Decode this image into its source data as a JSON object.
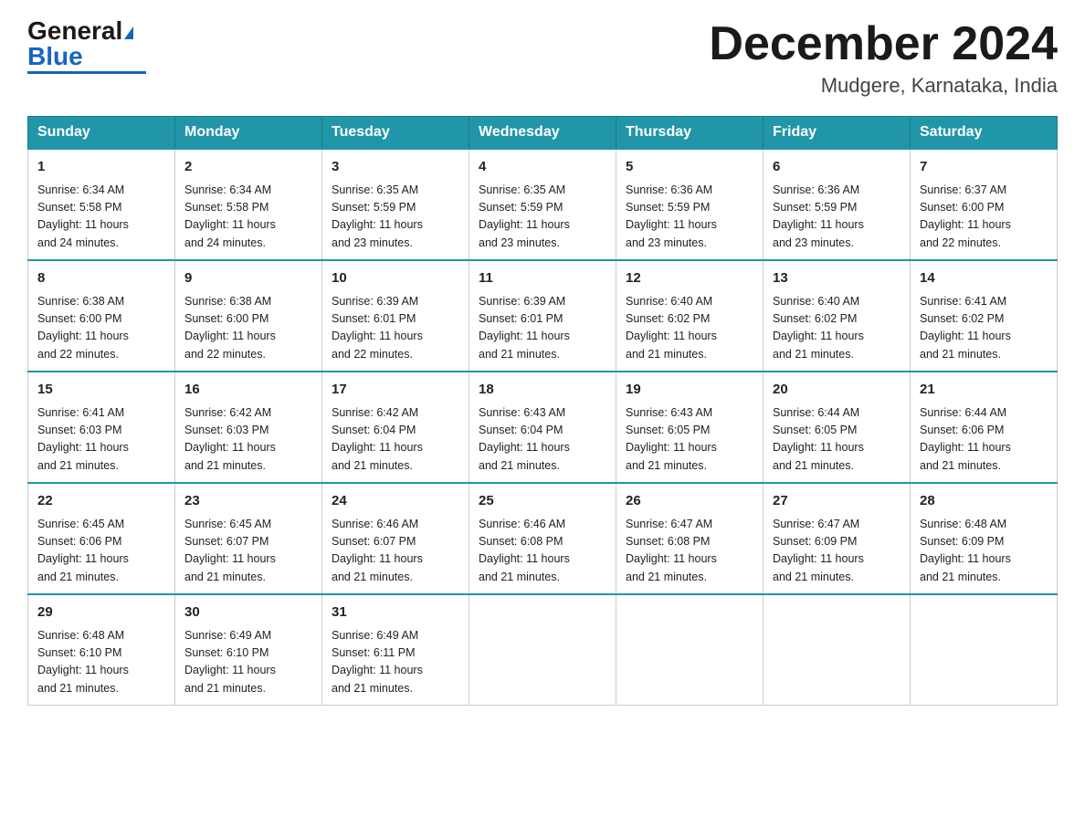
{
  "header": {
    "logo_general": "General",
    "logo_blue": "Blue",
    "month_title": "December 2024",
    "location": "Mudgere, Karnataka, India"
  },
  "days_of_week": [
    "Sunday",
    "Monday",
    "Tuesday",
    "Wednesday",
    "Thursday",
    "Friday",
    "Saturday"
  ],
  "weeks": [
    [
      {
        "day": "1",
        "sunrise": "6:34 AM",
        "sunset": "5:58 PM",
        "daylight": "11 hours and 24 minutes."
      },
      {
        "day": "2",
        "sunrise": "6:34 AM",
        "sunset": "5:58 PM",
        "daylight": "11 hours and 24 minutes."
      },
      {
        "day": "3",
        "sunrise": "6:35 AM",
        "sunset": "5:59 PM",
        "daylight": "11 hours and 23 minutes."
      },
      {
        "day": "4",
        "sunrise": "6:35 AM",
        "sunset": "5:59 PM",
        "daylight": "11 hours and 23 minutes."
      },
      {
        "day": "5",
        "sunrise": "6:36 AM",
        "sunset": "5:59 PM",
        "daylight": "11 hours and 23 minutes."
      },
      {
        "day": "6",
        "sunrise": "6:36 AM",
        "sunset": "5:59 PM",
        "daylight": "11 hours and 23 minutes."
      },
      {
        "day": "7",
        "sunrise": "6:37 AM",
        "sunset": "6:00 PM",
        "daylight": "11 hours and 22 minutes."
      }
    ],
    [
      {
        "day": "8",
        "sunrise": "6:38 AM",
        "sunset": "6:00 PM",
        "daylight": "11 hours and 22 minutes."
      },
      {
        "day": "9",
        "sunrise": "6:38 AM",
        "sunset": "6:00 PM",
        "daylight": "11 hours and 22 minutes."
      },
      {
        "day": "10",
        "sunrise": "6:39 AM",
        "sunset": "6:01 PM",
        "daylight": "11 hours and 22 minutes."
      },
      {
        "day": "11",
        "sunrise": "6:39 AM",
        "sunset": "6:01 PM",
        "daylight": "11 hours and 21 minutes."
      },
      {
        "day": "12",
        "sunrise": "6:40 AM",
        "sunset": "6:02 PM",
        "daylight": "11 hours and 21 minutes."
      },
      {
        "day": "13",
        "sunrise": "6:40 AM",
        "sunset": "6:02 PM",
        "daylight": "11 hours and 21 minutes."
      },
      {
        "day": "14",
        "sunrise": "6:41 AM",
        "sunset": "6:02 PM",
        "daylight": "11 hours and 21 minutes."
      }
    ],
    [
      {
        "day": "15",
        "sunrise": "6:41 AM",
        "sunset": "6:03 PM",
        "daylight": "11 hours and 21 minutes."
      },
      {
        "day": "16",
        "sunrise": "6:42 AM",
        "sunset": "6:03 PM",
        "daylight": "11 hours and 21 minutes."
      },
      {
        "day": "17",
        "sunrise": "6:42 AM",
        "sunset": "6:04 PM",
        "daylight": "11 hours and 21 minutes."
      },
      {
        "day": "18",
        "sunrise": "6:43 AM",
        "sunset": "6:04 PM",
        "daylight": "11 hours and 21 minutes."
      },
      {
        "day": "19",
        "sunrise": "6:43 AM",
        "sunset": "6:05 PM",
        "daylight": "11 hours and 21 minutes."
      },
      {
        "day": "20",
        "sunrise": "6:44 AM",
        "sunset": "6:05 PM",
        "daylight": "11 hours and 21 minutes."
      },
      {
        "day": "21",
        "sunrise": "6:44 AM",
        "sunset": "6:06 PM",
        "daylight": "11 hours and 21 minutes."
      }
    ],
    [
      {
        "day": "22",
        "sunrise": "6:45 AM",
        "sunset": "6:06 PM",
        "daylight": "11 hours and 21 minutes."
      },
      {
        "day": "23",
        "sunrise": "6:45 AM",
        "sunset": "6:07 PM",
        "daylight": "11 hours and 21 minutes."
      },
      {
        "day": "24",
        "sunrise": "6:46 AM",
        "sunset": "6:07 PM",
        "daylight": "11 hours and 21 minutes."
      },
      {
        "day": "25",
        "sunrise": "6:46 AM",
        "sunset": "6:08 PM",
        "daylight": "11 hours and 21 minutes."
      },
      {
        "day": "26",
        "sunrise": "6:47 AM",
        "sunset": "6:08 PM",
        "daylight": "11 hours and 21 minutes."
      },
      {
        "day": "27",
        "sunrise": "6:47 AM",
        "sunset": "6:09 PM",
        "daylight": "11 hours and 21 minutes."
      },
      {
        "day": "28",
        "sunrise": "6:48 AM",
        "sunset": "6:09 PM",
        "daylight": "11 hours and 21 minutes."
      }
    ],
    [
      {
        "day": "29",
        "sunrise": "6:48 AM",
        "sunset": "6:10 PM",
        "daylight": "11 hours and 21 minutes."
      },
      {
        "day": "30",
        "sunrise": "6:49 AM",
        "sunset": "6:10 PM",
        "daylight": "11 hours and 21 minutes."
      },
      {
        "day": "31",
        "sunrise": "6:49 AM",
        "sunset": "6:11 PM",
        "daylight": "11 hours and 21 minutes."
      },
      null,
      null,
      null,
      null
    ]
  ],
  "labels": {
    "sunrise": "Sunrise:",
    "sunset": "Sunset:",
    "daylight": "Daylight:"
  }
}
